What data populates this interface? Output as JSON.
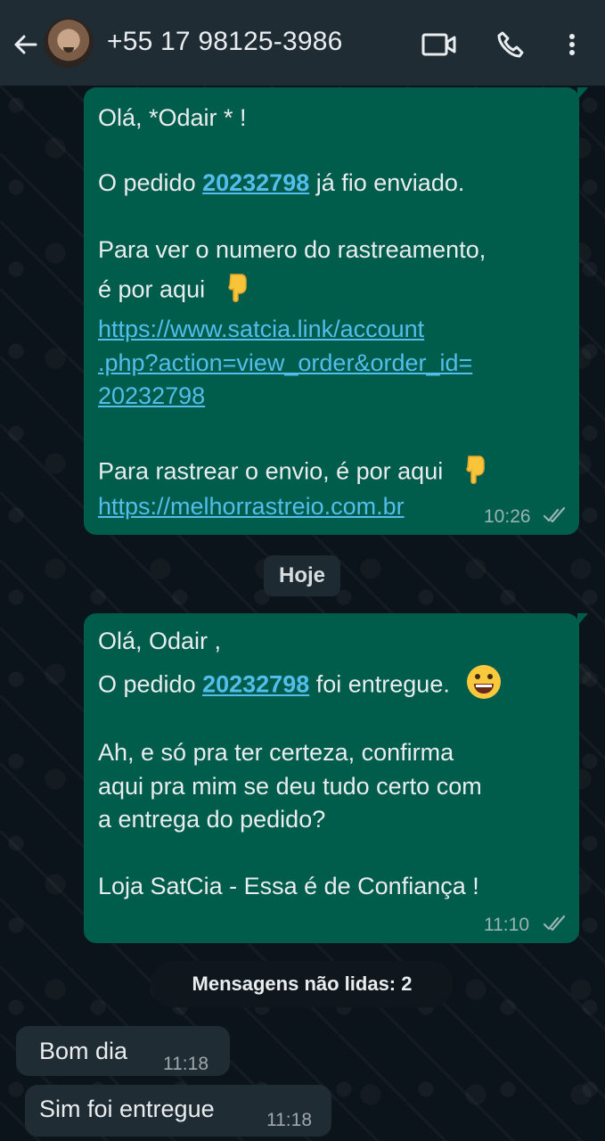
{
  "header": {
    "contact": "+55 17 98125-3986",
    "back_icon": "arrow-left-icon",
    "video_icon": "video-camera-icon",
    "call_icon": "phone-icon",
    "menu_icon": "more-vertical-icon"
  },
  "messages": [
    {
      "greeting": "Olá, *Odair * !",
      "line_order_prefix": "O pedido ",
      "order_number": "20232798",
      "line_order_suffix": " já fio enviado.",
      "tracking_line_1": "Para ver o numero do rastreamento,",
      "tracking_line_2": "é por aqui",
      "url_line_1": "https://www.satcia.link/account",
      "url_line_2": ".php?action=view_order&order_id=",
      "url_line_3": "20232798",
      "track_line": "Para rastrear o envio, é por aqui",
      "track_url": "https://melhorrastreio.com.br",
      "time": "10:26"
    },
    {
      "greeting": "Olá, Odair ,",
      "line_order_prefix": "O pedido ",
      "order_number": "20232798",
      "line_order_suffix": " foi entregue.",
      "confirm_line_1": "Ah, e só pra ter certeza, confirma",
      "confirm_line_2": "aqui pra mim se deu tudo certo com",
      "confirm_line_3": "a entrega do pedido?",
      "signature": "Loja SatCia - Essa é de Confiança !",
      "time": "11:10"
    }
  ],
  "date_chip": "Hoje",
  "unread_chip": "Mensagens não lidas: 2",
  "incoming": [
    {
      "text": "Bom dia",
      "time": "11:18"
    },
    {
      "text": "Sim foi entregue",
      "time": "11:18"
    }
  ],
  "colors": {
    "header": "#1f2c34",
    "outgoing_bubble": "#005c4b",
    "incoming_bubble": "#1f2c34",
    "link": "#53bdeb",
    "background": "#0b141a"
  }
}
